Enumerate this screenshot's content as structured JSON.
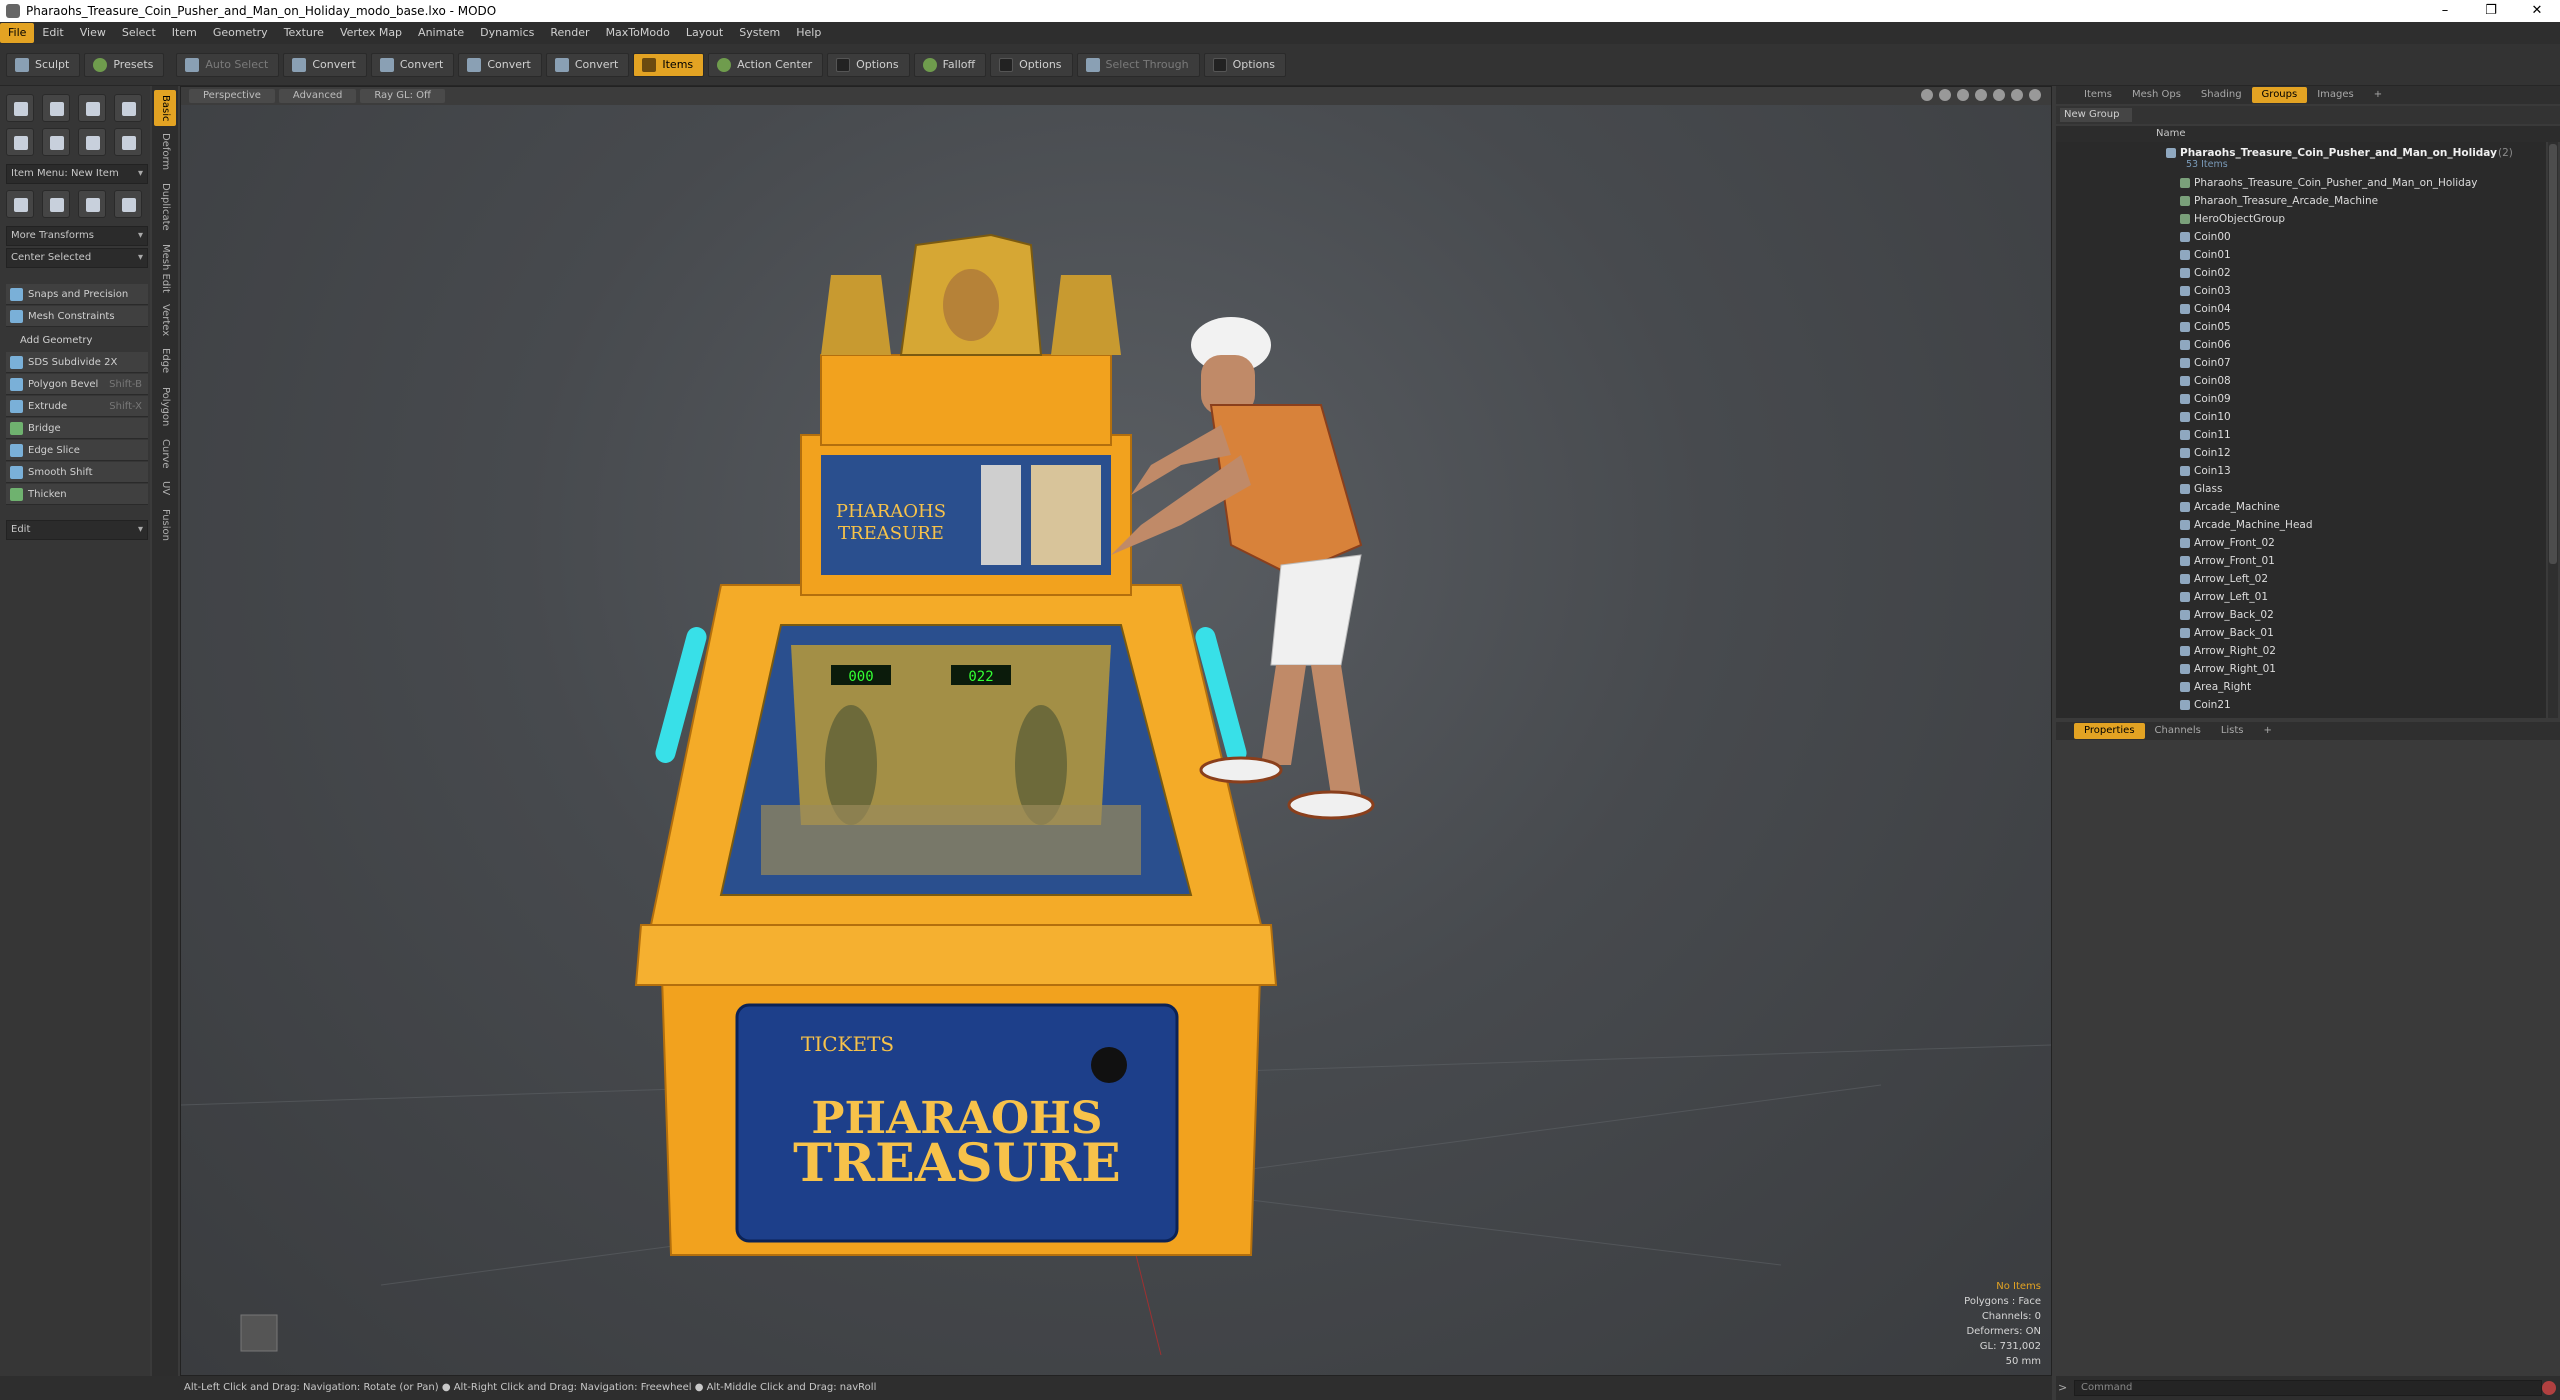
{
  "window": {
    "title": "Pharaohs_Treasure_Coin_Pusher_and_Man_on_Holiday_modo_base.lxo - MODO",
    "minimize": "–",
    "maximize": "❐",
    "close": "✕"
  },
  "menu": [
    "File",
    "Edit",
    "View",
    "Select",
    "Item",
    "Geometry",
    "Texture",
    "Vertex Map",
    "Animate",
    "Dynamics",
    "Render",
    "MaxToModo",
    "Layout",
    "System",
    "Help"
  ],
  "toolbar": {
    "sculpt": "Sculpt",
    "presets": "Presets",
    "auto_select": "Auto Select",
    "convert": "Convert",
    "items": "Items",
    "action_center": "Action Center",
    "options": "Options",
    "falloff": "Falloff",
    "select_through": "Select Through"
  },
  "left": {
    "item_menu": "Item Menu: New Item",
    "more_transforms": "More Transforms",
    "center_selected": "Center Selected",
    "snaps": "Snaps and Precision",
    "mesh_constraints": "Mesh Constraints",
    "add_geometry": "Add Geometry",
    "tools": [
      {
        "label": "SDS Subdivide 2X",
        "shortcut": ""
      },
      {
        "label": "Polygon Bevel",
        "shortcut": "Shift-B"
      },
      {
        "label": "Extrude",
        "shortcut": "Shift-X"
      },
      {
        "label": "Bridge",
        "shortcut": ""
      },
      {
        "label": "Edge Slice",
        "shortcut": ""
      },
      {
        "label": "Smooth Shift",
        "shortcut": ""
      },
      {
        "label": "Thicken",
        "shortcut": ""
      }
    ],
    "edit": "Edit",
    "vtabs": [
      "Basic",
      "Deform",
      "Duplicate",
      "Mesh Edit",
      "Vertex",
      "Edge",
      "Polygon",
      "Curve",
      "UV",
      "Fusion"
    ]
  },
  "viewport": {
    "tabs": [
      "Perspective",
      "Advanced",
      "Ray GL: Off"
    ],
    "info": {
      "items": "No Items",
      "polygons": "Polygons : Face",
      "channels": "Channels: 0",
      "deformers": "Deformers: ON",
      "gl": "GL: 731,002",
      "scale": "50 mm"
    }
  },
  "right": {
    "top_tabs": [
      "Items",
      "Mesh Ops",
      "Shading",
      "Groups",
      "Images",
      "+"
    ],
    "new_group": "New Group",
    "col_name": "Name",
    "root": {
      "name": "Pharaohs_Treasure_Coin_Pusher_and_Man_on_Holiday",
      "count": "(2)",
      "sub": "53 Items"
    },
    "items": [
      "Pharaohs_Treasure_Coin_Pusher_and_Man_on_Holiday",
      "Pharaoh_Treasure_Arcade_Machine",
      "HeroObjectGroup",
      "Coin00",
      "Coin01",
      "Coin02",
      "Coin03",
      "Coin04",
      "Coin05",
      "Coin06",
      "Coin07",
      "Coin08",
      "Coin09",
      "Coin10",
      "Coin11",
      "Coin12",
      "Coin13",
      "Glass",
      "Arcade_Machine",
      "Arcade_Machine_Head",
      "Arrow_Front_02",
      "Arrow_Front_01",
      "Arrow_Left_02",
      "Arrow_Left_01",
      "Arrow_Back_02",
      "Arrow_Back_01",
      "Arrow_Right_02",
      "Arrow_Right_01",
      "Area_Right",
      "Coin21"
    ],
    "bottom_tabs": [
      "Properties",
      "Channels",
      "Lists",
      "+"
    ]
  },
  "status": "Alt-Left Click and Drag: Navigation: Rotate (or Pan) ● Alt-Right Click and Drag: Navigation: Freewheel ● Alt-Middle Click and Drag: navRoll",
  "command_placeholder": "Command",
  "colors": {
    "accent": "#e3a323",
    "cabinet": "#f2a21e",
    "screen": "#1d3f8a",
    "shirt": "#d8823a"
  }
}
